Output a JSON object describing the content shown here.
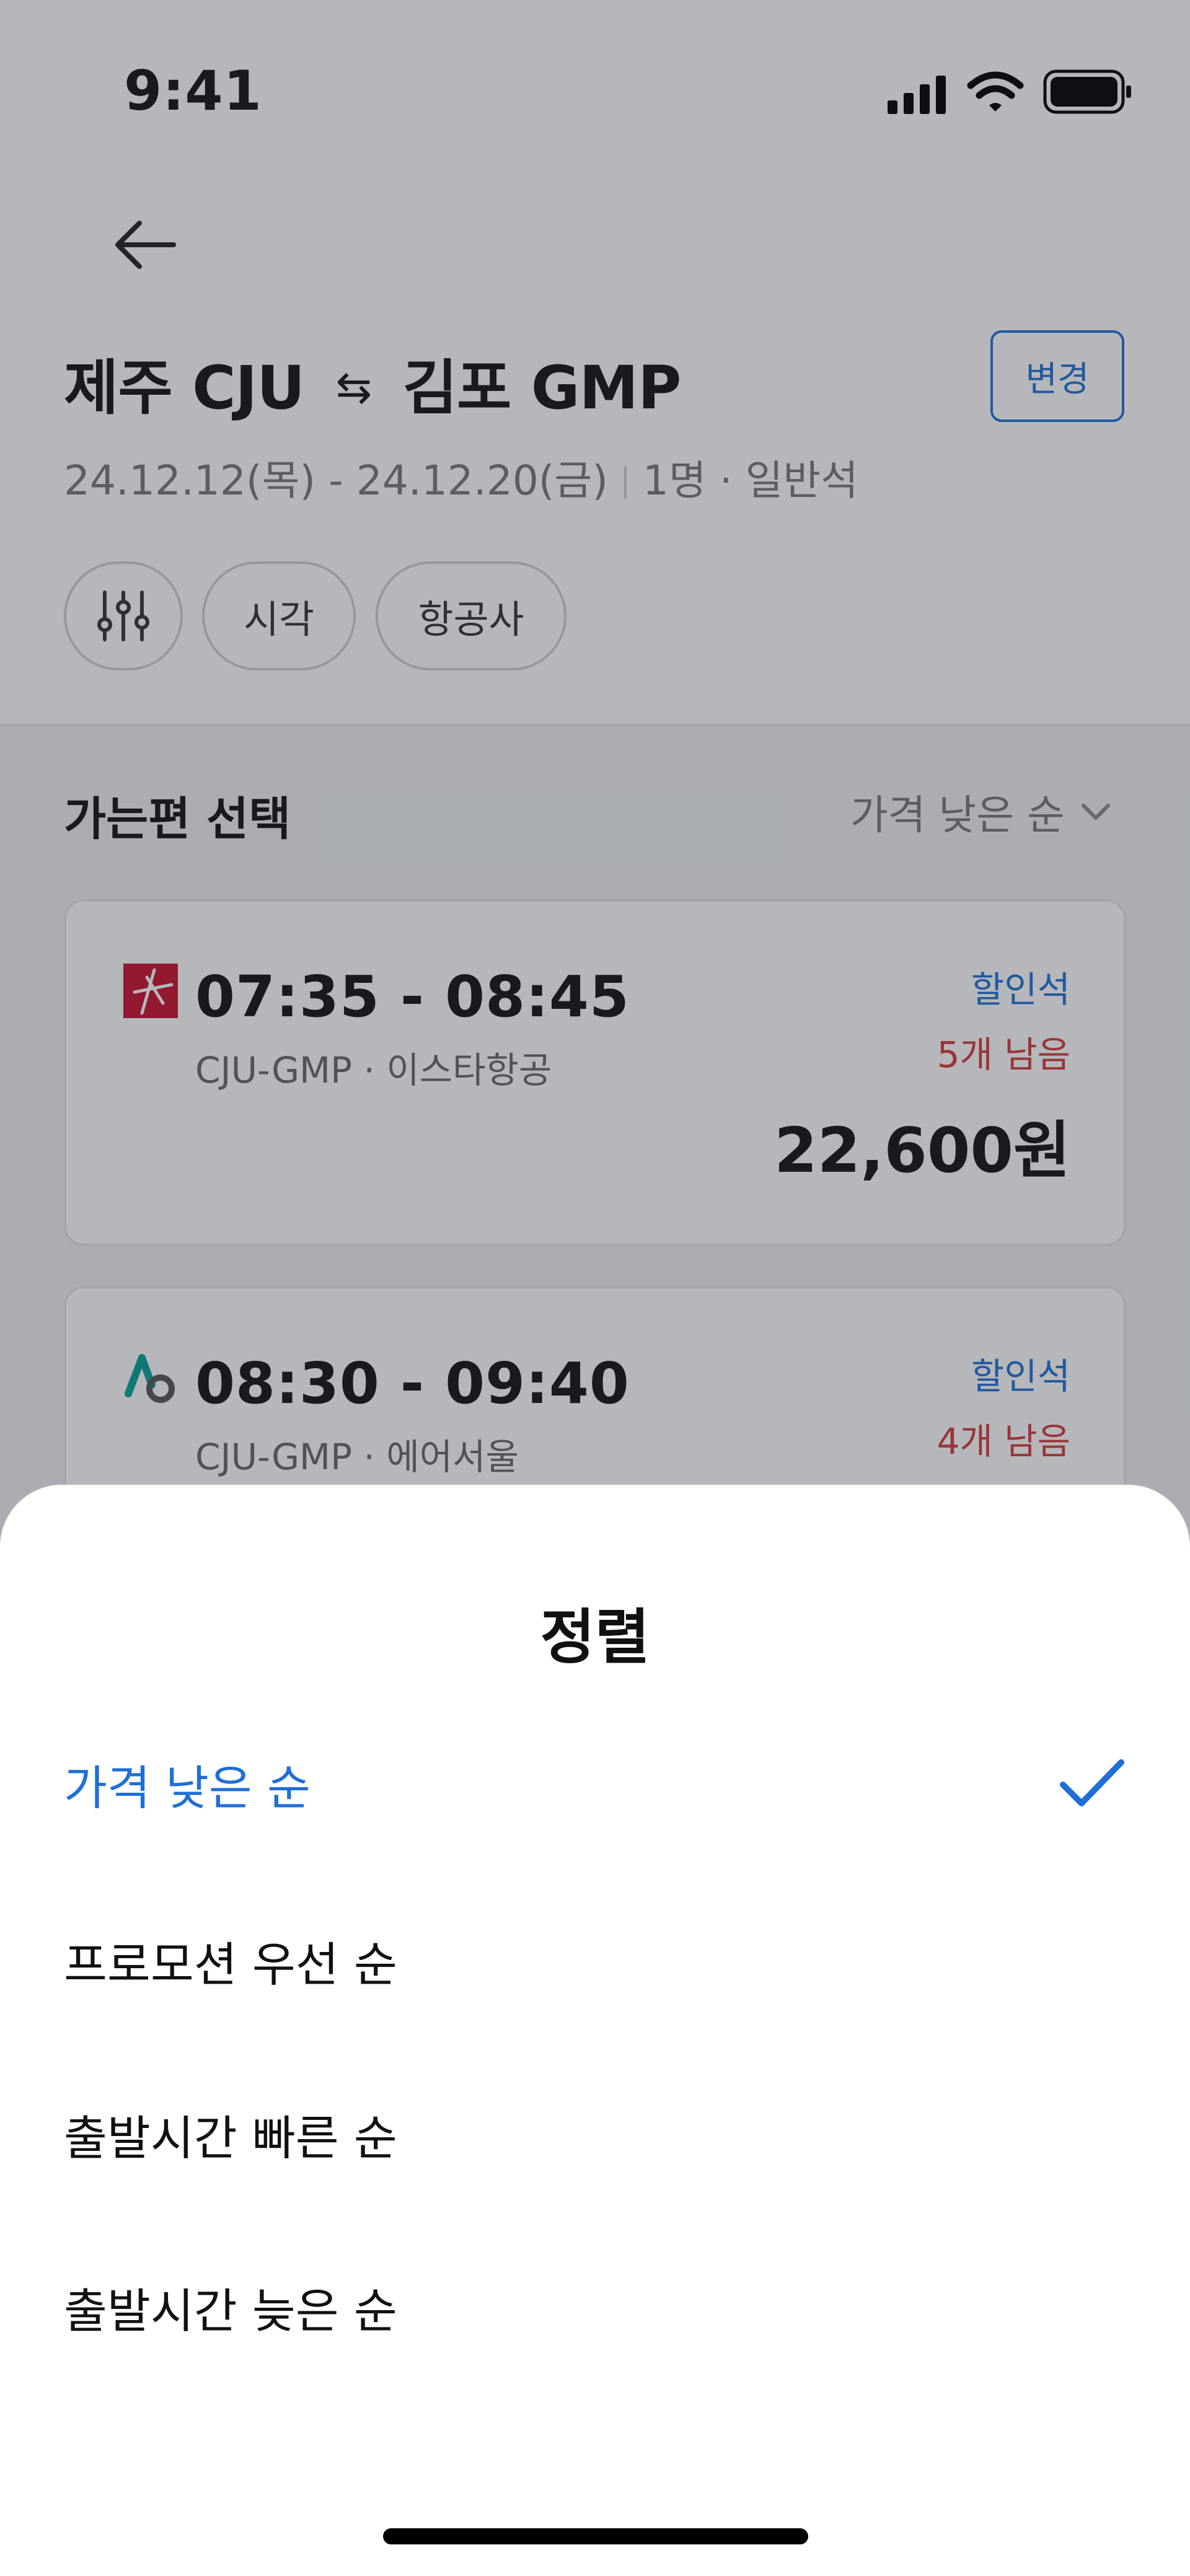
{
  "status": {
    "time": "9:41"
  },
  "header": {
    "origin_city": "제주",
    "origin_code": "CJU",
    "swap_symbol": "⇆",
    "destination_city": "김포",
    "destination_code": "GMP",
    "change_label": "변경",
    "dates": "24.12.12(목) - 24.12.20(금)",
    "passengers": "1명 · 일반석"
  },
  "filters": {
    "time_label": "시각",
    "airline_label": "항공사"
  },
  "list": {
    "section_title": "가는편 선택",
    "sort_label": "가격 낮은 순",
    "flights": [
      {
        "times": "07:35 - 08:45",
        "info": "CJU-GMP · 이스타항공",
        "fare_type": "할인석",
        "seats_left": "5개 남음",
        "price": "22,600원",
        "logo_color": "#c8102e"
      },
      {
        "times": "08:30 - 09:40",
        "info": "CJU-GMP · 에어서울",
        "fare_type": "할인석",
        "seats_left": "4개 남음",
        "logo_color": "#00a19a"
      }
    ]
  },
  "sheet": {
    "title": "정렬",
    "options": [
      {
        "label": "가격 낮은 순",
        "selected": true
      },
      {
        "label": "프로모션 우선 순",
        "selected": false
      },
      {
        "label": "출발시간 빠른 순",
        "selected": false
      },
      {
        "label": "출발시간 늦은 순",
        "selected": false
      }
    ]
  },
  "colors": {
    "accent": "#1f6fd6",
    "warning": "#d23a3a"
  }
}
